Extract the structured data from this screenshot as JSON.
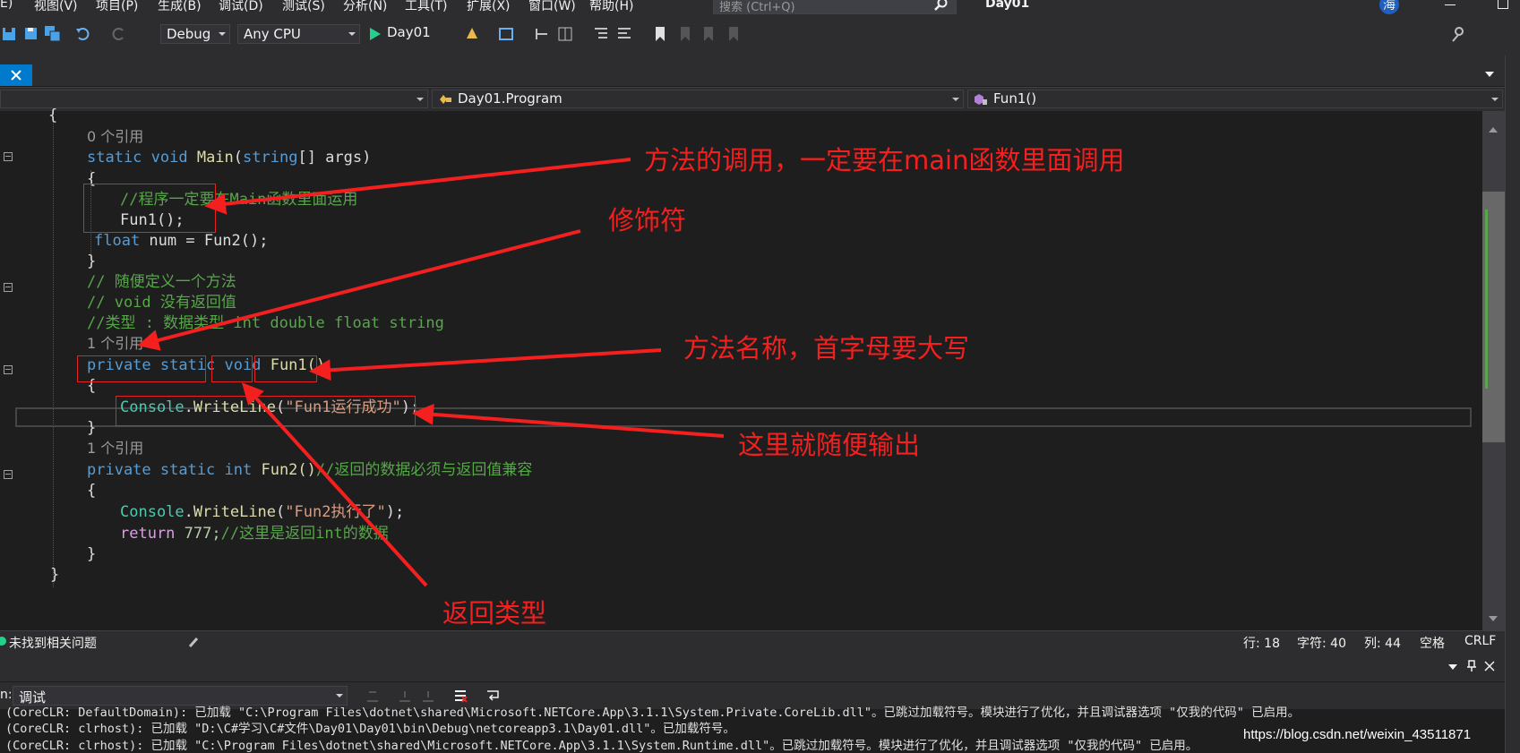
{
  "menu": {
    "items": [
      "E)",
      "视图(V)",
      "项目(P)",
      "生成(B)",
      "调试(D)",
      "测试(S)",
      "分析(N)",
      "工具(T)",
      "扩展(X)",
      "窗口(W)",
      "帮助(H)"
    ],
    "search_placeholder": "搜索 (Ctrl+Q)",
    "solution_name": "Day01",
    "user_initial": "海"
  },
  "toolbar": {
    "config": "Debug",
    "platform": "Any CPU",
    "start_target": "Day01"
  },
  "navbar": {
    "type": "Day01.Program",
    "member": "Fun1()"
  },
  "code": {
    "l0": "{",
    "ref_main": "0 个引用",
    "main_kw": "static void ",
    "main_name": "Main",
    "main_open": "(",
    "main_type": "string",
    "main_rest": "[] args)",
    "brace_open": "{",
    "comment_main": "//程序一定要在Main函数里面运用",
    "call_fun1": "Fun1();",
    "float_kw": "float",
    "float_rest": " num = Fun2();",
    "brace_close": "}",
    "c1": "// 随便定义一个方法",
    "c2": "// void 没有返回值",
    "c3": "//类型 : 数据类型 int double float string",
    "ref_fun1": "1 个引用",
    "fun1_kw": "private static void ",
    "fun1_name": "Fun1()",
    "console1_type": "Console",
    "console1_dot": ".",
    "console1_m": "WriteLine",
    "console1_open": "(",
    "console1_str": "\"Fun1运行成功\"",
    "console1_close": ");",
    "ref_fun2": "1 个引用",
    "fun2_kw": "private static int ",
    "fun2_name": "Fun2()",
    "fun2_comment": "//返回的数据必须与返回值兼容",
    "console2_type": "Console",
    "console2_m": "WriteLine",
    "console2_str": "\"Fun2执行了\"",
    "console2_close": ");",
    "ret_kw": "return",
    "ret_num": " 777;",
    "ret_comment": "//这里是返回int的数据",
    "class_close": "}"
  },
  "annotations": {
    "a1": "方法的调用，一定要在main函数里面调用",
    "a2": "修饰符",
    "a3": "方法名称，首字母要大写",
    "a4": "这里就随便输出",
    "a5": "返回类型"
  },
  "status": {
    "issues": "未找到相关问题",
    "line": "行: 18",
    "char": "字符: 40",
    "col": "列: 44",
    "spaces": "空格",
    "eol": "CRLF"
  },
  "output": {
    "source_label": "n:",
    "source": "调试",
    "lines": [
      "(CoreCLR: DefaultDomain): 已加载 \"C:\\Program Files\\dotnet\\shared\\Microsoft.NETCore.App\\3.1.1\\System.Private.CoreLib.dll\"。已跳过加载符号。模块进行了优化，并且调试器选项 \"仅我的代码\" 已启用。",
      "(CoreCLR: clrhost): 已加载 \"D:\\C#学习\\C#文件\\Day01\\Day01\\bin\\Debug\\netcoreapp3.1\\Day01.dll\"。已加载符号。",
      "(CoreCLR: clrhost): 已加载 \"C:\\Program Files\\dotnet\\shared\\Microsoft.NETCore.App\\3.1.1\\System.Runtime.dll\"。已跳过加载符号。模块进行了优化，并且调试器选项 \"仅我的代码\" 已启用。"
    ]
  },
  "watermark": "https://blog.csdn.net/weixin_43511871",
  "colors": {
    "accent": "#007acc",
    "annotation": "#f41f1f"
  }
}
